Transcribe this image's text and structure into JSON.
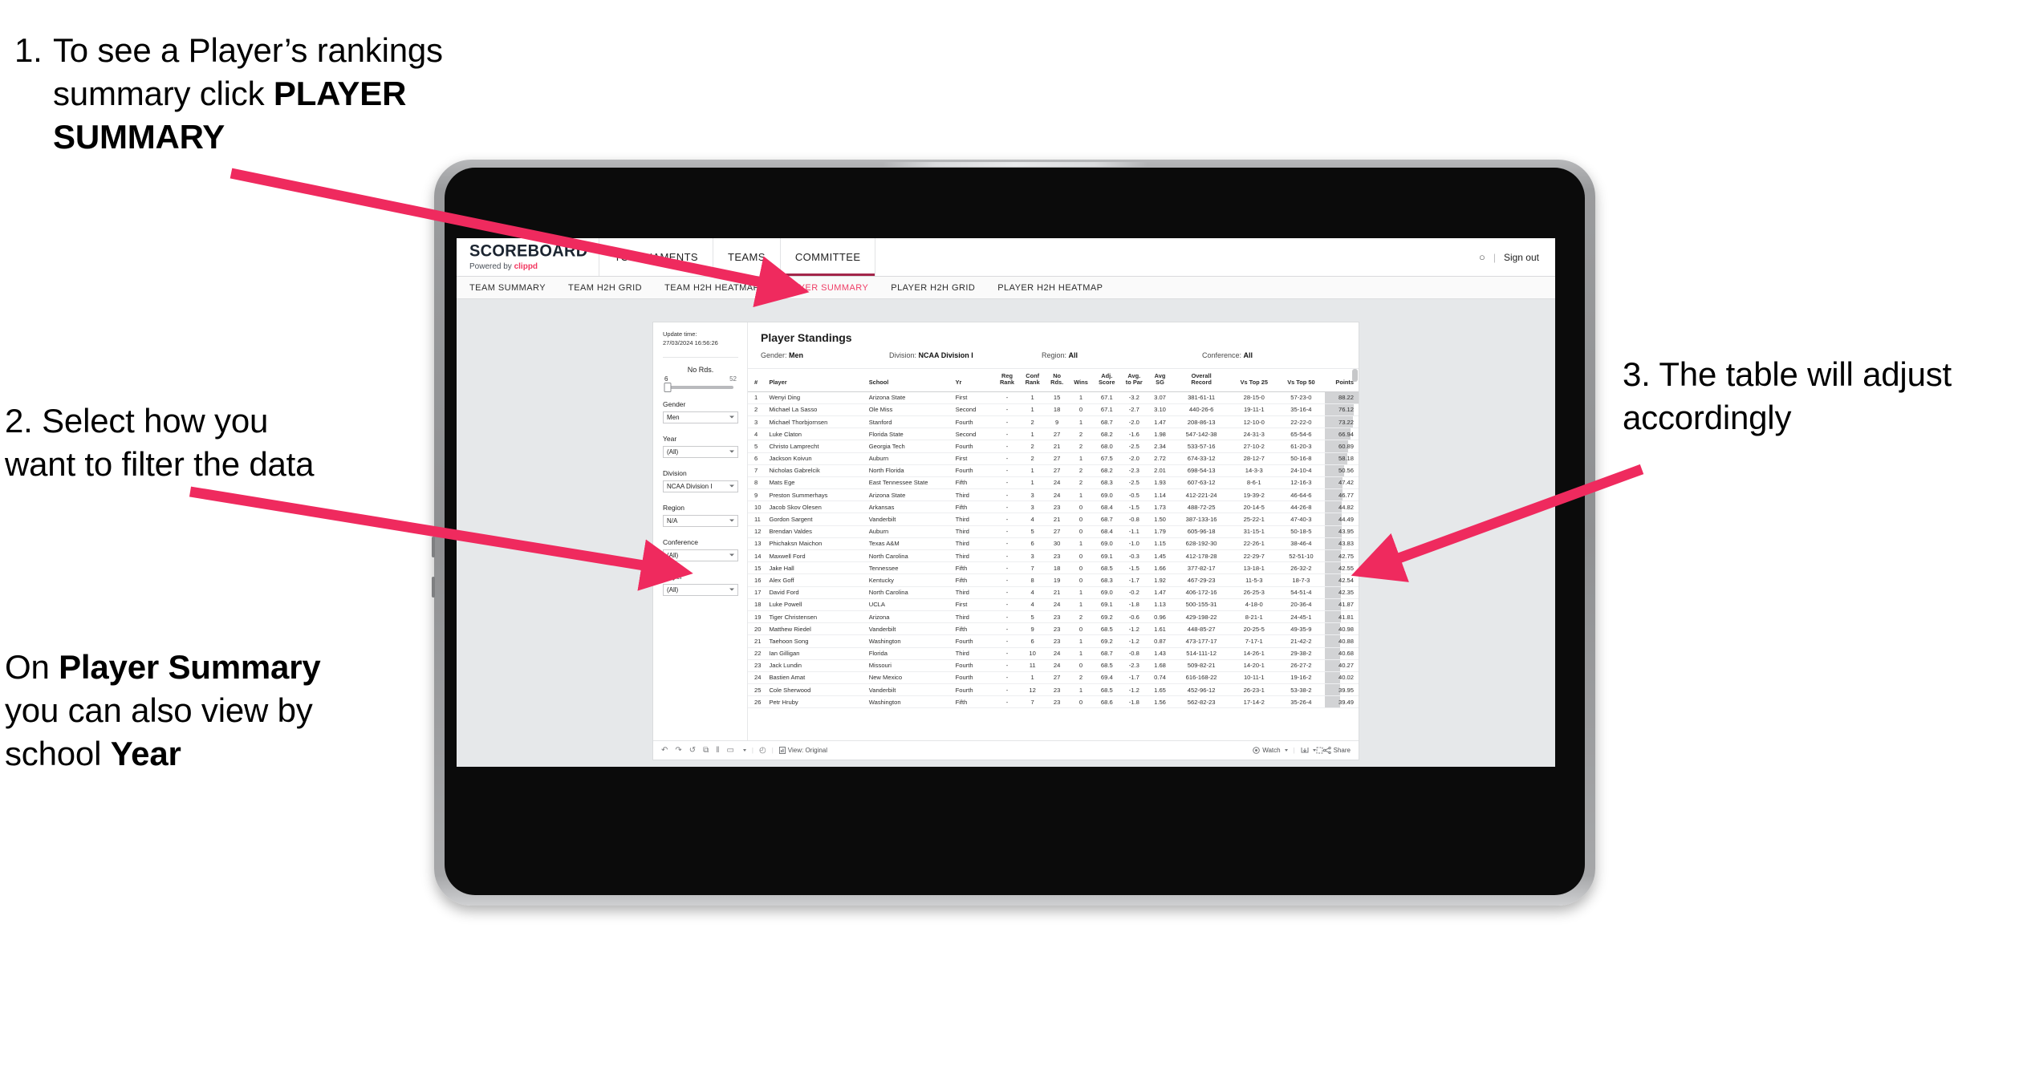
{
  "annotations": {
    "step1_number": "1.",
    "step1_line1": "To see a Player’s rankings",
    "step1_line2_pre": "summary click ",
    "step1_line2_bold": "PLAYER",
    "step1_line3_bold": "SUMMARY",
    "step2": "2. Select how you want to filter the data",
    "step2_note_pre": "On ",
    "step2_note_b1": "Player Summary",
    "step2_note_mid": " you can also view by school ",
    "step2_note_b2": "Year",
    "step3": "3. The table will adjust accordingly"
  },
  "app": {
    "brand_title": "SCOREBOARD",
    "brand_sub_pre": "Powered by ",
    "brand_sub_name": "clippd",
    "header_tabs": [
      "TOURNAMENTS",
      "TEAMS",
      "COMMITTEE"
    ],
    "header_active_tab": "COMMITTEE",
    "user_glyph": "○",
    "sign_out": "Sign out",
    "subnav_tabs": [
      "TEAM SUMMARY",
      "TEAM H2H GRID",
      "TEAM H2H HEATMAP",
      "PLAYER SUMMARY",
      "PLAYER H2H GRID",
      "PLAYER H2H HEATMAP"
    ],
    "subnav_active": "PLAYER SUMMARY",
    "accent_pink": "#ef3e66",
    "accent_underline": "#a3264a"
  },
  "filters": {
    "update_label": "Update time:",
    "update_value": "27/03/2024 16:56:26",
    "slider": {
      "label": "No Rds.",
      "min": "6",
      "max": "52",
      "value": 6
    },
    "selects": [
      {
        "label": "Gender",
        "value": "Men"
      },
      {
        "label": "Year",
        "value": "(All)"
      },
      {
        "label": "Division",
        "value": "NCAA Division I"
      },
      {
        "label": "Region",
        "value": "N/A"
      },
      {
        "label": "Conference",
        "value": "(All)"
      },
      {
        "label": "Player",
        "value": "(All)"
      }
    ]
  },
  "sheet": {
    "title": "Player Standings",
    "summary": [
      {
        "key": "Gender:",
        "value": "Men"
      },
      {
        "key": "Division:",
        "value": "NCAA Division I"
      },
      {
        "key": "Region:",
        "value": "All"
      },
      {
        "key": "Conference:",
        "value": "All"
      }
    ]
  },
  "table": {
    "headers": [
      "#",
      "Player",
      "School",
      "Yr",
      "Reg Rank",
      "Conf Rank",
      "No Rds.",
      "Wins",
      "Adj. Score",
      "Avg. to Par",
      "Avg SG",
      "Overall Record",
      "Vs Top 25",
      "Vs Top 50",
      "Points"
    ],
    "headers_wrapped": [
      [
        "#"
      ],
      [
        "Player"
      ],
      [
        "School"
      ],
      [
        "Yr"
      ],
      [
        "Reg",
        "Rank"
      ],
      [
        "Conf",
        "Rank"
      ],
      [
        "No",
        "Rds."
      ],
      [
        "Wins"
      ],
      [
        "Adj.",
        "Score"
      ],
      [
        "Avg.",
        "to Par"
      ],
      [
        "Avg",
        "SG"
      ],
      [
        "Overall",
        "Record"
      ],
      [
        "Vs Top 25"
      ],
      [
        "Vs Top 50"
      ],
      [
        "Points"
      ]
    ],
    "rows": [
      [
        "1",
        "Wenyi Ding",
        "Arizona State",
        "First",
        "-",
        "1",
        "15",
        "1",
        "67.1",
        "-3.2",
        "3.07",
        "381-61-11",
        "28-15-0",
        "57-23-0",
        "88.22"
      ],
      [
        "2",
        "Michael La Sasso",
        "Ole Miss",
        "Second",
        "-",
        "1",
        "18",
        "0",
        "67.1",
        "-2.7",
        "3.10",
        "440-26-6",
        "19-11-1",
        "35-16-4",
        "76.12"
      ],
      [
        "3",
        "Michael Thorbjornsen",
        "Stanford",
        "Fourth",
        "-",
        "2",
        "9",
        "1",
        "68.7",
        "-2.0",
        "1.47",
        "208-86-13",
        "12-10-0",
        "22-22-0",
        "73.22"
      ],
      [
        "4",
        "Luke Claton",
        "Florida State",
        "Second",
        "-",
        "1",
        "27",
        "2",
        "68.2",
        "-1.6",
        "1.98",
        "547-142-38",
        "24-31-3",
        "65-54-6",
        "66.94"
      ],
      [
        "5",
        "Christo Lamprecht",
        "Georgia Tech",
        "Fourth",
        "-",
        "2",
        "21",
        "2",
        "68.0",
        "-2.5",
        "2.34",
        "533-57-16",
        "27-10-2",
        "61-20-3",
        "60.89"
      ],
      [
        "6",
        "Jackson Koivun",
        "Auburn",
        "First",
        "-",
        "2",
        "27",
        "1",
        "67.5",
        "-2.0",
        "2.72",
        "674-33-12",
        "28-12-7",
        "50-16-8",
        "58.18"
      ],
      [
        "7",
        "Nicholas Gabrelcik",
        "North Florida",
        "Fourth",
        "-",
        "1",
        "27",
        "2",
        "68.2",
        "-2.3",
        "2.01",
        "698-54-13",
        "14-3-3",
        "24-10-4",
        "50.56"
      ],
      [
        "8",
        "Mats Ege",
        "East Tennessee State",
        "Fifth",
        "-",
        "1",
        "24",
        "2",
        "68.3",
        "-2.5",
        "1.93",
        "607-63-12",
        "8-6-1",
        "12-16-3",
        "47.42"
      ],
      [
        "9",
        "Preston Summerhays",
        "Arizona State",
        "Third",
        "-",
        "3",
        "24",
        "1",
        "69.0",
        "-0.5",
        "1.14",
        "412-221-24",
        "19-39-2",
        "46-64-6",
        "46.77"
      ],
      [
        "10",
        "Jacob Skov Olesen",
        "Arkansas",
        "Fifth",
        "-",
        "3",
        "23",
        "0",
        "68.4",
        "-1.5",
        "1.73",
        "488-72-25",
        "20-14-5",
        "44-26-8",
        "44.82"
      ],
      [
        "11",
        "Gordon Sargent",
        "Vanderbilt",
        "Third",
        "-",
        "4",
        "21",
        "0",
        "68.7",
        "-0.8",
        "1.50",
        "387-133-16",
        "25-22-1",
        "47-40-3",
        "44.49"
      ],
      [
        "12",
        "Brendan Valdes",
        "Auburn",
        "Third",
        "-",
        "5",
        "27",
        "0",
        "68.4",
        "-1.1",
        "1.79",
        "605-96-18",
        "31-15-1",
        "50-18-5",
        "43.95"
      ],
      [
        "13",
        "Phichaksn Maichon",
        "Texas A&M",
        "Third",
        "-",
        "6",
        "30",
        "1",
        "69.0",
        "-1.0",
        "1.15",
        "628-192-30",
        "22-26-1",
        "38-46-4",
        "43.83"
      ],
      [
        "14",
        "Maxwell Ford",
        "North Carolina",
        "Third",
        "-",
        "3",
        "23",
        "0",
        "69.1",
        "-0.3",
        "1.45",
        "412-178-28",
        "22-29-7",
        "52-51-10",
        "42.75"
      ],
      [
        "15",
        "Jake Hall",
        "Tennessee",
        "Fifth",
        "-",
        "7",
        "18",
        "0",
        "68.5",
        "-1.5",
        "1.66",
        "377-82-17",
        "13-18-1",
        "26-32-2",
        "42.55"
      ],
      [
        "16",
        "Alex Goff",
        "Kentucky",
        "Fifth",
        "-",
        "8",
        "19",
        "0",
        "68.3",
        "-1.7",
        "1.92",
        "467-29-23",
        "11-5-3",
        "18-7-3",
        "42.54"
      ],
      [
        "17",
        "David Ford",
        "North Carolina",
        "Third",
        "-",
        "4",
        "21",
        "1",
        "69.0",
        "-0.2",
        "1.47",
        "406-172-16",
        "26-25-3",
        "54-51-4",
        "42.35"
      ],
      [
        "18",
        "Luke Powell",
        "UCLA",
        "First",
        "-",
        "4",
        "24",
        "1",
        "69.1",
        "-1.8",
        "1.13",
        "500-155-31",
        "4-18-0",
        "20-36-4",
        "41.87"
      ],
      [
        "19",
        "Tiger Christensen",
        "Arizona",
        "Third",
        "-",
        "5",
        "23",
        "2",
        "69.2",
        "-0.6",
        "0.96",
        "429-198-22",
        "8-21-1",
        "24-45-1",
        "41.81"
      ],
      [
        "20",
        "Matthew Riedel",
        "Vanderbilt",
        "Fifth",
        "-",
        "9",
        "23",
        "0",
        "68.5",
        "-1.2",
        "1.61",
        "448-85-27",
        "20-25-5",
        "49-35-9",
        "40.98"
      ],
      [
        "21",
        "Taehoon Song",
        "Washington",
        "Fourth",
        "-",
        "6",
        "23",
        "1",
        "69.2",
        "-1.2",
        "0.87",
        "473-177-17",
        "7-17-1",
        "21-42-2",
        "40.88"
      ],
      [
        "22",
        "Ian Gilligan",
        "Florida",
        "Third",
        "-",
        "10",
        "24",
        "1",
        "68.7",
        "-0.8",
        "1.43",
        "514-111-12",
        "14-26-1",
        "29-38-2",
        "40.68"
      ],
      [
        "23",
        "Jack Lundin",
        "Missouri",
        "Fourth",
        "-",
        "11",
        "24",
        "0",
        "68.5",
        "-2.3",
        "1.68",
        "509-82-21",
        "14-20-1",
        "26-27-2",
        "40.27"
      ],
      [
        "24",
        "Bastien Amat",
        "New Mexico",
        "Fourth",
        "-",
        "1",
        "27",
        "2",
        "69.4",
        "-1.7",
        "0.74",
        "616-168-22",
        "10-11-1",
        "19-16-2",
        "40.02"
      ],
      [
        "25",
        "Cole Sherwood",
        "Vanderbilt",
        "Fourth",
        "-",
        "12",
        "23",
        "1",
        "68.5",
        "-1.2",
        "1.65",
        "452-96-12",
        "26-23-1",
        "53-38-2",
        "39.95"
      ],
      [
        "26",
        "Petr Hruby",
        "Washington",
        "Fifth",
        "-",
        "7",
        "23",
        "0",
        "68.6",
        "-1.8",
        "1.56",
        "562-82-23",
        "17-14-2",
        "35-26-4",
        "39.49"
      ]
    ],
    "points_max": 88.22
  },
  "toolbar": {
    "undo": "↶",
    "redo": "↷",
    "revert": "↺",
    "refresh": "⧉",
    "pause": "‖",
    "stop": "▭",
    "clock": "◴",
    "view_label": "View: Original",
    "watch_label": "Watch",
    "share_label": "Share"
  }
}
